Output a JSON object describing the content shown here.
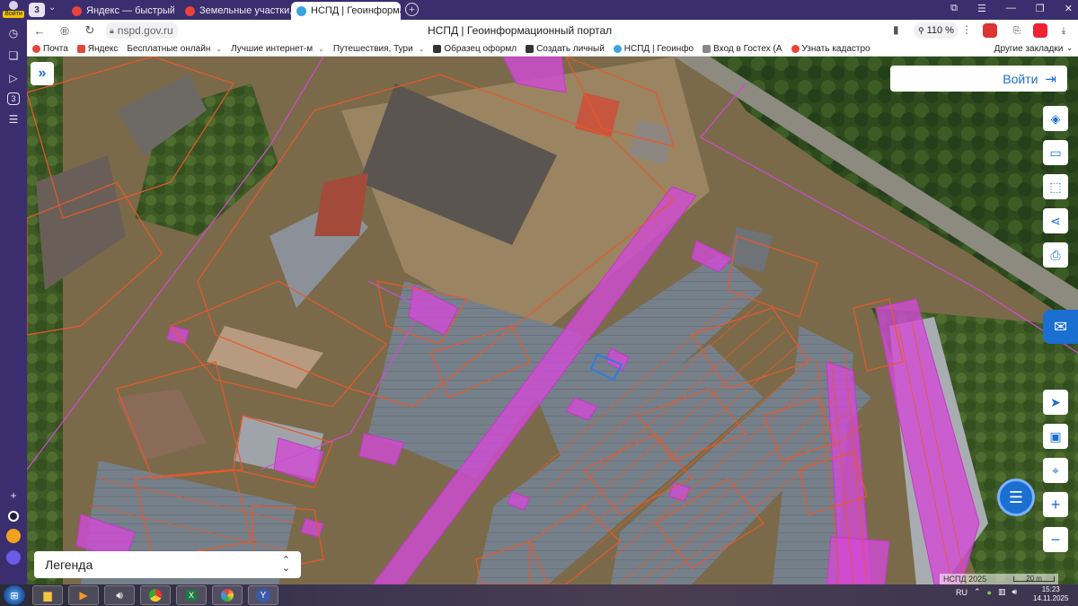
{
  "browser": {
    "sidebar": {
      "login_label": "Войти"
    },
    "tab_count": "3",
    "tabs": [
      {
        "title": "Яндекс — быстрый поиск",
        "favicon_color": "#e8443a",
        "favicon_letter": "Я"
      },
      {
        "title": "Земельные участки, своб",
        "favicon_color": "#e8443a",
        "favicon_letter": "Я"
      },
      {
        "title": "НСПД | Геоинформаци",
        "favicon_color": "#3aa3e0",
        "favicon_letter": ""
      }
    ],
    "url": "nspd.gov.ru",
    "page_title": "НСПД | Геоинформационный портал",
    "zoom": "110 %",
    "bookmarks": [
      {
        "label": "Почта",
        "color": "#e8443a",
        "has_menu": false
      },
      {
        "label": "Яндекс",
        "color": "#e8443a",
        "has_menu": false
      },
      {
        "label": "Бесплатные онлайн",
        "color": "#cccccc",
        "has_menu": true
      },
      {
        "label": "Лучшие интернет-м",
        "color": "#cccccc",
        "has_menu": true
      },
      {
        "label": "Путешествия, Тури",
        "color": "#cccccc",
        "has_menu": true
      },
      {
        "label": "Образец оформл",
        "color": "#333333",
        "has_menu": false
      },
      {
        "label": "Создать личный",
        "color": "#333333",
        "has_menu": false
      },
      {
        "label": "НСПД | Геоинфо",
        "color": "#3aa3e0",
        "has_menu": false
      },
      {
        "label": "Вход в Гостех (А",
        "color": "#888888",
        "has_menu": false
      },
      {
        "label": "Узнать кадастро",
        "color": "#e8443a",
        "has_menu": false
      }
    ],
    "other_bookmarks": "Другие закладки"
  },
  "map": {
    "login_label": "Войти",
    "legend_label": "Легенда",
    "attribution": "НСПД 2025",
    "scale_label": "20 m",
    "tools_top": [
      {
        "name": "layers-icon",
        "glyph": "◈"
      },
      {
        "name": "ruler-icon",
        "glyph": "▭"
      },
      {
        "name": "select-area-icon",
        "glyph": "⬚"
      },
      {
        "name": "share-icon",
        "glyph": "⋖"
      },
      {
        "name": "print-icon",
        "glyph": "⎙"
      }
    ],
    "tools_bottom": [
      {
        "name": "geolocation-icon",
        "glyph": "➤"
      },
      {
        "name": "minimap-icon",
        "glyph": "▣"
      },
      {
        "name": "place-search-icon",
        "glyph": "⌖"
      },
      {
        "name": "zoom-in-icon",
        "glyph": "+"
      },
      {
        "name": "zoom-out-icon",
        "glyph": "−"
      }
    ],
    "colors": {
      "parcel_outline": "#e8582b",
      "highlight_fill": "#d24ad6",
      "selection": "#2f7be5",
      "ui_accent": "#1a6fd1"
    }
  },
  "taskbar": {
    "language": "RU",
    "time": "15:23",
    "date": "14.11.2025"
  }
}
